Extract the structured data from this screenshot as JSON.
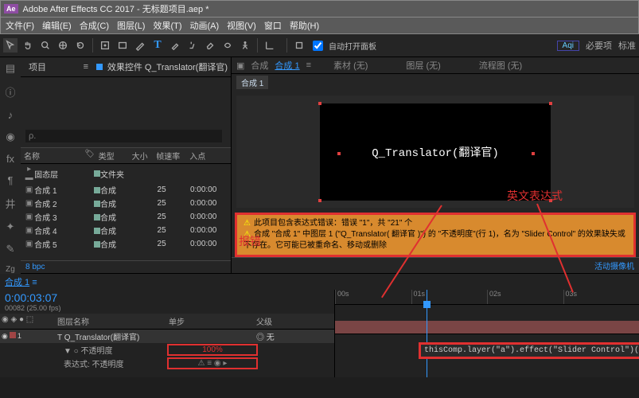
{
  "title": "Adobe After Effects CC 2017 - 无标题项目.aep *",
  "menu": [
    "文件(F)",
    "编辑(E)",
    "合成(C)",
    "图层(L)",
    "效果(T)",
    "动画(A)",
    "视图(V)",
    "窗口",
    "帮助(H)"
  ],
  "toolbar": {
    "auto_open": "自动打开面板",
    "tab1": "Aqi",
    "tab2": "必要项",
    "tab3": "标准"
  },
  "project": {
    "tab": "项目",
    "effect_tab": "效果控件 Q_Translator(翻译官)",
    "search_ph": "ρ.",
    "headers": {
      "name": "名称",
      "type": "类型",
      "size": "大小",
      "fr": "帧速率",
      "in": "入点"
    },
    "items": [
      {
        "name": "固态层",
        "type": "文件夹",
        "fr": "",
        "in": ""
      },
      {
        "name": "合成 1",
        "type": "合成",
        "fr": "25",
        "in": "0:00:00"
      },
      {
        "name": "合成 2",
        "type": "合成",
        "fr": "25",
        "in": "0:00:00"
      },
      {
        "name": "合成 3",
        "type": "合成",
        "fr": "25",
        "in": "0:00:00"
      },
      {
        "name": "合成 4",
        "type": "合成",
        "fr": "25",
        "in": "0:00:00"
      },
      {
        "name": "合成 5",
        "type": "合成",
        "fr": "25",
        "in": "0:00:00"
      }
    ],
    "status": "8 bpc"
  },
  "viewer": {
    "tabs": {
      "comp": "合成",
      "active": "合成 1",
      "material": "素材 (无)",
      "layer": "图层 (无)",
      "flow": "流程图 (无)"
    },
    "comp_name": "合成 1",
    "canvas_text": "Q_Translator(翻译官)"
  },
  "error": {
    "line1": "此项目包含表达式错误：错误 \"1\"，共 \"21\" 个",
    "line2": "合成 \"合成 1\" 中图层 1 (\"Q_Translator( 翻译官 )\") 的 \"不透明度\"(行 1)，名为 \"Slider Control\" 的效果缺失或不存在。它可能已被重命名、移动或删除"
  },
  "annotations": {
    "a1": "英文表达式",
    "a2": "报错"
  },
  "timeline": {
    "tab": "合成 1",
    "time": "0:00:03:07",
    "frames": "00082 (25.00 fps)",
    "cols": {
      "c2": "图层名称",
      "c3": "单步",
      "c4": "父级"
    },
    "layer": {
      "idx": "1",
      "name": "T  Q_Translator(翻译官)",
      "mode": "◎ 无"
    },
    "prop": "▼ ○ 不透明度",
    "expr_label": "表达式: 不透明度",
    "value": "100%",
    "expr_code": "thisComp.layer(\"a\").effect(\"Slider Control\")(\"slider\")",
    "ticks": [
      "00s",
      "01s",
      "02s",
      "03s"
    ],
    "camera": "活动摄像机"
  }
}
